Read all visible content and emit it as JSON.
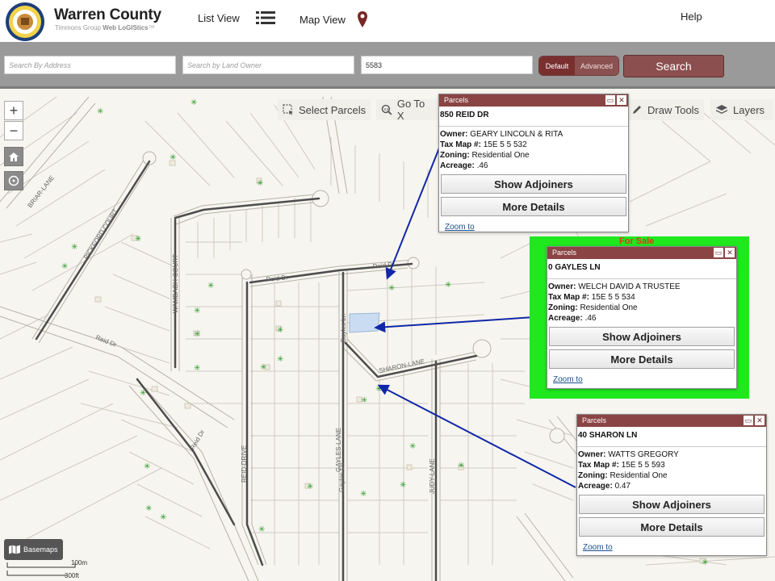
{
  "header": {
    "title": "Warren County",
    "subtitle_prefix": "Timmons Group ",
    "subtitle_brand": "Web LoGIStics",
    "subtitle_tm": "™",
    "nav_list_view": "List View",
    "nav_map_view": "Map View",
    "nav_help": "Help"
  },
  "search": {
    "address_placeholder": "Search By Address",
    "owner_placeholder": "Search by Land Owner",
    "query_value": "5583",
    "mode_default": "Default",
    "mode_advanced": "Advanced",
    "search_label": "Search"
  },
  "map_tools": {
    "zoom_in": "+",
    "zoom_out": "−",
    "select_parcels": "Select Parcels",
    "go_to_xy": "Go To X",
    "draw_tools": "Draw Tools",
    "layers": "Layers",
    "basemaps": "Basemaps",
    "scale_m": "100m",
    "scale_ft": "300ft"
  },
  "roads": {
    "briar_lane": "BRIAR-LANE",
    "pickford_court": "PICKFORD COURT",
    "wambagh_court": "WAMBAGH-COURT",
    "reid_dr_top": "Reid Dr",
    "reid_dr_mid": "Reid Dr",
    "reid_dr_left": "Reid Dr",
    "reid_dr_bottom": "Reid Dr",
    "reid_drive": "REID-DRIVE",
    "gayles_lane": "GAYLES-LANE",
    "gayles_ln": "Gayles Ln",
    "gayles_ln_2": "Gayles Ln",
    "sharon_lane": "SHARON-LANE",
    "judy_lane": "JUDY-LANE"
  },
  "popups": [
    {
      "title": "Parcels",
      "address": "850 REID DR",
      "owner_label": "Owner:",
      "owner": "GEARY LINCOLN & RITA",
      "taxmap_label": "Tax Map #:",
      "taxmap": "15E 5 5 532",
      "zoning_label": "Zoning:",
      "zoning": "Residential One",
      "acreage_label": "Acreage:",
      "acreage": ".46",
      "show_adjoiners": "Show Adjoiners",
      "more_details": "More Details",
      "zoom_to": "Zoom to"
    },
    {
      "title": "Parcels",
      "address": "0 GAYLES LN",
      "owner_label": "Owner:",
      "owner": "WELCH DAVID A TRUSTEE",
      "taxmap_label": "Tax Map #:",
      "taxmap": "15E 5 5 534",
      "zoning_label": "Zoning:",
      "zoning": "Residential One",
      "acreage_label": "Acreage:",
      "acreage": ".46",
      "show_adjoiners": "Show Adjoiners",
      "more_details": "More Details",
      "zoom_to": "Zoom to"
    },
    {
      "title": "Parcels",
      "address": "40 SHARON LN",
      "owner_label": "Owner:",
      "owner": "WATTS GREGORY",
      "taxmap_label": "Tax Map #:",
      "taxmap": "15E 5 5 593",
      "zoning_label": "Zoning:",
      "zoning": "Residential One",
      "acreage_label": "Acreage:",
      "acreage": "0.47",
      "show_adjoiners": "Show Adjoiners",
      "more_details": "More Details",
      "zoom_to": "Zoom to"
    }
  ],
  "for_sale_label": "For Sale",
  "colors": {
    "accent_maroon": "#8b4444",
    "for_sale_green": "#1fe81f",
    "for_sale_text": "#d83a1a",
    "arrow_blue": "#1028a8",
    "highlight_parcel": "#c9dcf2"
  }
}
